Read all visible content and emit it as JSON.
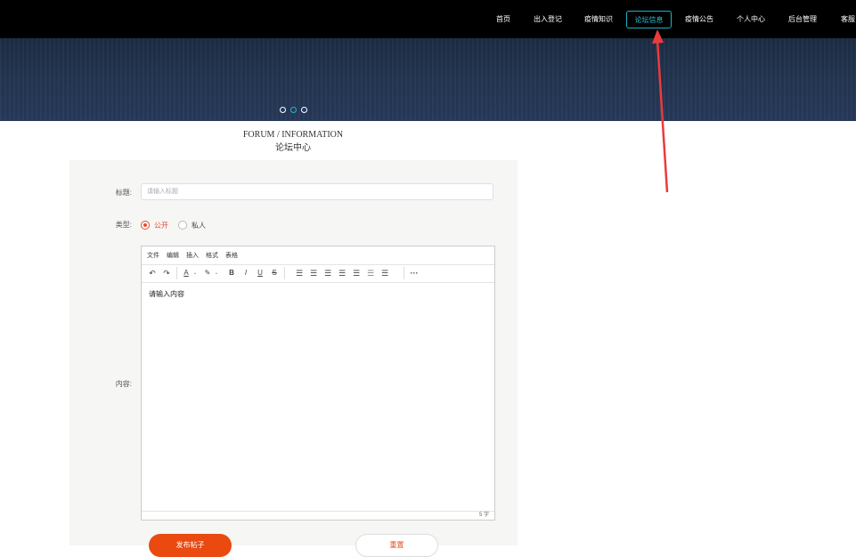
{
  "nav": {
    "items": [
      {
        "label": "首页"
      },
      {
        "label": "出入登记"
      },
      {
        "label": "疫情知识"
      },
      {
        "label": "论坛信息"
      },
      {
        "label": "疫情公告"
      },
      {
        "label": "个人中心"
      },
      {
        "label": "后台管理"
      },
      {
        "label": "客服"
      }
    ],
    "active_index": 3,
    "active_color": "#1bb3c3"
  },
  "banner": {
    "slide_count": 3,
    "active_slide": 1
  },
  "heading": {
    "english": "FORUM / INFORMATION",
    "chinese": "论坛中心"
  },
  "form": {
    "title_label": "标题:",
    "title_placeholder": "请输入标题",
    "type_label": "类型:",
    "type_options": [
      {
        "label": "公开",
        "checked": true
      },
      {
        "label": "私人",
        "checked": false
      }
    ],
    "content_label": "内容:",
    "accent_color": "#e84a2c"
  },
  "editor": {
    "menus": [
      "文件",
      "编辑",
      "插入",
      "格式",
      "表格"
    ],
    "toolbar_icons": [
      "undo-icon",
      "redo-icon",
      "font-color-icon",
      "highlight-icon",
      "bold-icon",
      "italic-icon",
      "underline-icon",
      "strikethrough-icon",
      "list-icon",
      "align-left-icon",
      "align-center-icon",
      "align-right-icon",
      "justify-icon",
      "outdent-icon",
      "indent-icon",
      "more-icon"
    ],
    "content": "请输入内容",
    "word_count": "5 字"
  },
  "buttons": {
    "submit": "发布帖子",
    "reset": "重置",
    "submit_color": "#ea4a10"
  }
}
